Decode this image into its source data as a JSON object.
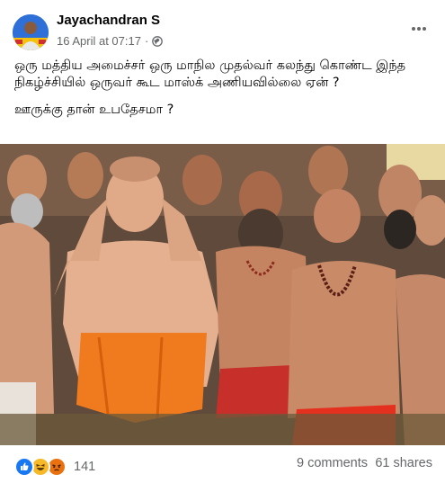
{
  "post": {
    "author": "Jayachandran S",
    "date": "16 April at 07:17",
    "separator": "·",
    "privacy_icon": "globe-icon",
    "more_icon": "more-options-icon",
    "text_line1": "ஒரு மத்திய அமைச்சர் ஒரு மாநில முதல்வர் கலந்து கொண்ட இந்த நிகழ்ச்சியில் ஒருவர் கூட மாஸ்க் அணியவில்லை ஏன் ?",
    "text_line2": "ஊருக்கு தான் உபதேசமா ?"
  },
  "footer": {
    "reaction_icons": [
      "like-icon",
      "haha-icon",
      "angry-icon"
    ],
    "reaction_count": "141",
    "comments": "9 comments",
    "shares": "61 shares"
  },
  "colors": {
    "like_blue": "#1877f2",
    "haha_yellow": "#f7b928",
    "angry_orange": "#e9710f",
    "secondary_text": "#65676b"
  }
}
